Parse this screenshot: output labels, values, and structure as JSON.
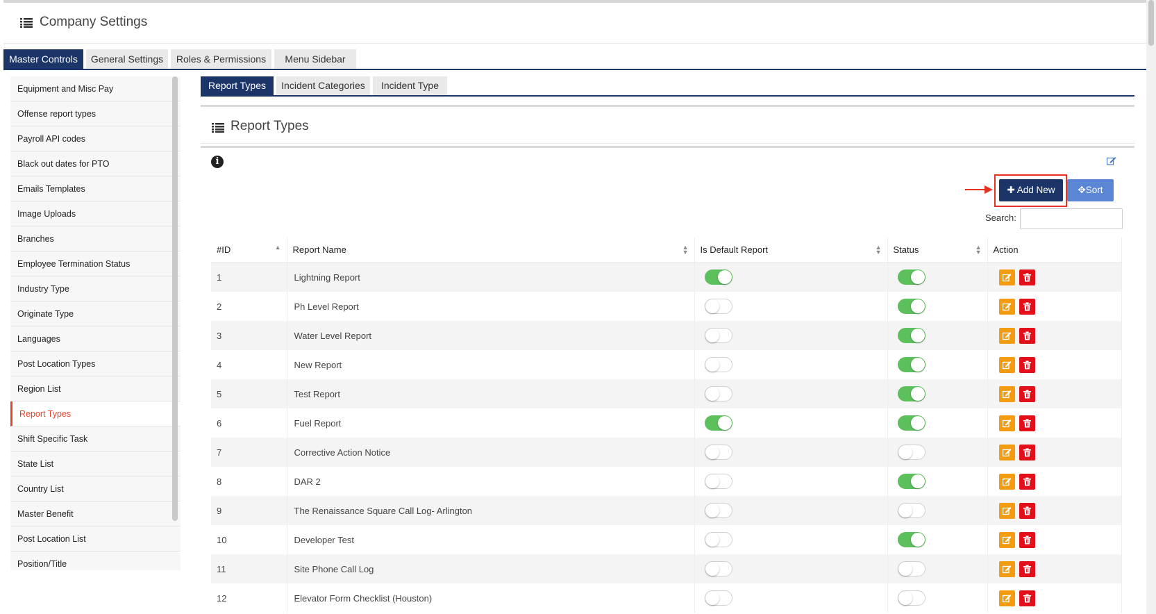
{
  "header": {
    "title": "Company Settings"
  },
  "main_tabs": [
    "Master Controls",
    "General Settings",
    "Roles & Permissions",
    "Menu Sidebar"
  ],
  "sidebar": {
    "items": [
      "Equipment and Misc Pay",
      "Offense report types",
      "Payroll API codes",
      "Black out dates for PTO",
      "Emails Templates",
      "Image Uploads",
      "Branches",
      "Employee Termination Status",
      "Industry Type",
      "Originate Type",
      "Languages",
      "Post Location Types",
      "Region List",
      "Report Types",
      "Shift Specific Task",
      "State List",
      "Country List",
      "Master Benefit",
      "Post Location List",
      "Position/Title"
    ],
    "active": "Report Types"
  },
  "sub_tabs": [
    "Report Types",
    "Incident Categories",
    "Incident Type"
  ],
  "panel": {
    "title": "Report Types"
  },
  "buttons": {
    "add_new": "Add New",
    "sort": "Sort"
  },
  "search": {
    "label": "Search:",
    "value": ""
  },
  "table": {
    "columns": [
      "#ID",
      "Report Name",
      "Is Default Report",
      "Status",
      "Action"
    ],
    "rows": [
      {
        "id": "1",
        "name": "Lightning Report",
        "is_default": true,
        "status": true
      },
      {
        "id": "2",
        "name": "Ph Level Report",
        "is_default": false,
        "status": true
      },
      {
        "id": "3",
        "name": "Water Level Report",
        "is_default": false,
        "status": true
      },
      {
        "id": "4",
        "name": "New Report",
        "is_default": false,
        "status": true
      },
      {
        "id": "5",
        "name": "Test Report",
        "is_default": false,
        "status": true
      },
      {
        "id": "6",
        "name": "Fuel Report",
        "is_default": true,
        "status": true
      },
      {
        "id": "7",
        "name": "Corrective Action Notice",
        "is_default": false,
        "status": false
      },
      {
        "id": "8",
        "name": "DAR 2",
        "is_default": false,
        "status": true
      },
      {
        "id": "9",
        "name": "The Renaissance Square Call Log- Arlington",
        "is_default": false,
        "status": false
      },
      {
        "id": "10",
        "name": "Developer Test",
        "is_default": false,
        "status": true
      },
      {
        "id": "11",
        "name": "Site Phone Call Log",
        "is_default": false,
        "status": false
      },
      {
        "id": "12",
        "name": "Elevator Form Checklist (Houston)",
        "is_default": false,
        "status": false
      }
    ]
  },
  "colors": {
    "primary": "#1c3569",
    "accent": "#e5462b",
    "toggle_on": "#5cc05c",
    "edit": "#f39c12",
    "delete": "#e30f1b",
    "sort_btn": "#5b86d6"
  }
}
